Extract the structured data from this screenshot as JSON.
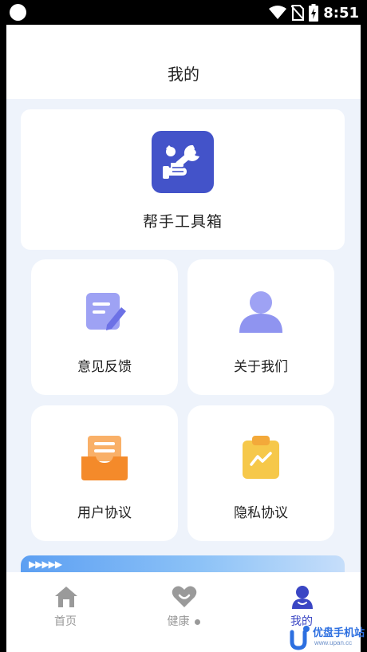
{
  "status_bar": {
    "time": "8:51",
    "icons": [
      "wifi-icon",
      "no-sim-icon",
      "battery-charging-icon"
    ]
  },
  "header": {
    "title": "我的"
  },
  "toolbox": {
    "label": "帮手工具箱",
    "icon": "wrench-hand-icon",
    "icon_color": "#4353c9"
  },
  "tiles": [
    {
      "label": "意见反馈",
      "icon": "feedback-edit-icon",
      "color": "#8f94f0"
    },
    {
      "label": "关于我们",
      "icon": "user-profile-icon",
      "color": "#8f94f0"
    },
    {
      "label": "用户协议",
      "icon": "document-tray-icon",
      "color": "#f48a2a"
    },
    {
      "label": "隐私协议",
      "icon": "clipboard-chart-icon",
      "color": "#f6c84a"
    }
  ],
  "banner": {
    "arrows": "▶▶▶▶▶"
  },
  "tabbar": {
    "tabs": [
      {
        "label": "首页",
        "icon": "home-icon",
        "active": false
      },
      {
        "label": "健康",
        "icon": "heart-smile-icon",
        "active": false
      },
      {
        "label": "我的",
        "icon": "profile-icon",
        "active": true
      }
    ],
    "active_color": "#3a46c4",
    "inactive_color": "#999999"
  },
  "watermark": {
    "text": "优盘手机站",
    "url": "www.upan.cc"
  }
}
